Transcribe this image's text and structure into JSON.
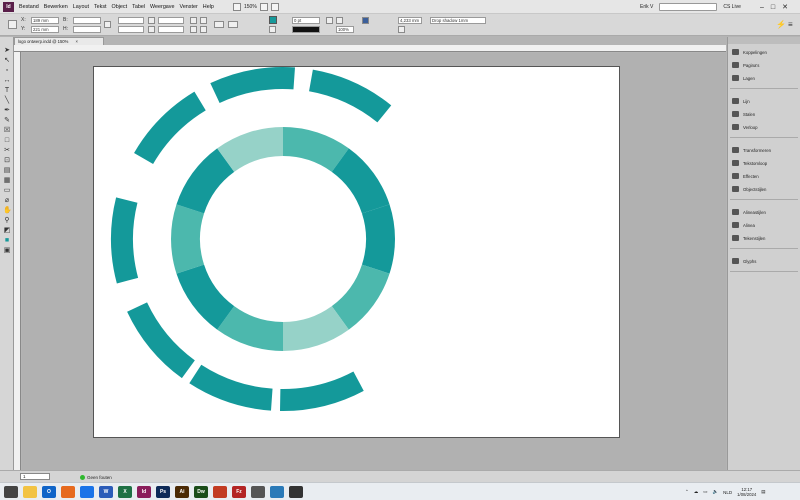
{
  "app": {
    "logo": "Id",
    "menus": [
      "Bestand",
      "Bewerken",
      "Layout",
      "Tekst",
      "Object",
      "Tabel",
      "Weergave",
      "Venster",
      "Help"
    ],
    "zoom": "150%",
    "user": "Erik V",
    "cs_live": "CS Live"
  },
  "control": {
    "x_label": "X:",
    "x_value": "189 mm",
    "y_label": "Y:",
    "y_value": "221 mm",
    "w_label": "B:",
    "h_label": "H:",
    "stroke_weight": "0 pt",
    "opacity": "100%",
    "gap_value": "4,233 mm",
    "effect": "Drop shadow 1mm",
    "fill_color": "#16999a"
  },
  "document": {
    "tab_title": "logo ontwerp.indd @ 150%"
  },
  "artwork": {
    "outer_color": "#14999a",
    "inner_colors": [
      "#4cb8ad",
      "#14999a",
      "#14999a",
      "#4cb8ad",
      "#96d2c8",
      "#4cb8ad",
      "#14999a",
      "#4cb8ad",
      "#14999a",
      "#96d2c8"
    ]
  },
  "panels": {
    "groups": [
      [
        "Koppelingen",
        "Pagina's",
        "Lagen"
      ],
      [
        "Lijn",
        "Stalen",
        "Verloop"
      ],
      [
        "Transformeren",
        "Tekstomloop",
        "Effecten",
        "Objectstijlen"
      ],
      [
        "Alineastijlen",
        "Alinea",
        "Tekenstijlen"
      ],
      [
        "Glyphs"
      ]
    ]
  },
  "status": {
    "page": "1",
    "preflight": "Geen fouten"
  },
  "taskbar": {
    "language": "NLD",
    "time": "12:17",
    "date": "1/08/2024",
    "apps": [
      {
        "label": "",
        "color": "#444"
      },
      {
        "label": "",
        "color": "#f2c343"
      },
      {
        "label": "O",
        "color": "#0f64c8"
      },
      {
        "label": "",
        "color": "#e66a1f"
      },
      {
        "label": "",
        "color": "#1a73e8"
      },
      {
        "label": "W",
        "color": "#2b5cb8"
      },
      {
        "label": "X",
        "color": "#1e7145"
      },
      {
        "label": "Id",
        "color": "#8a1d5b"
      },
      {
        "label": "Ps",
        "color": "#0d2a58"
      },
      {
        "label": "Ai",
        "color": "#4a2a05"
      },
      {
        "label": "Dw",
        "color": "#1a4d1a"
      },
      {
        "label": "",
        "color": "#c23b22"
      },
      {
        "label": "Fz",
        "color": "#b32424"
      },
      {
        "label": "",
        "color": "#555"
      },
      {
        "label": "",
        "color": "#2a7ab8"
      },
      {
        "label": "",
        "color": "#333"
      }
    ]
  }
}
